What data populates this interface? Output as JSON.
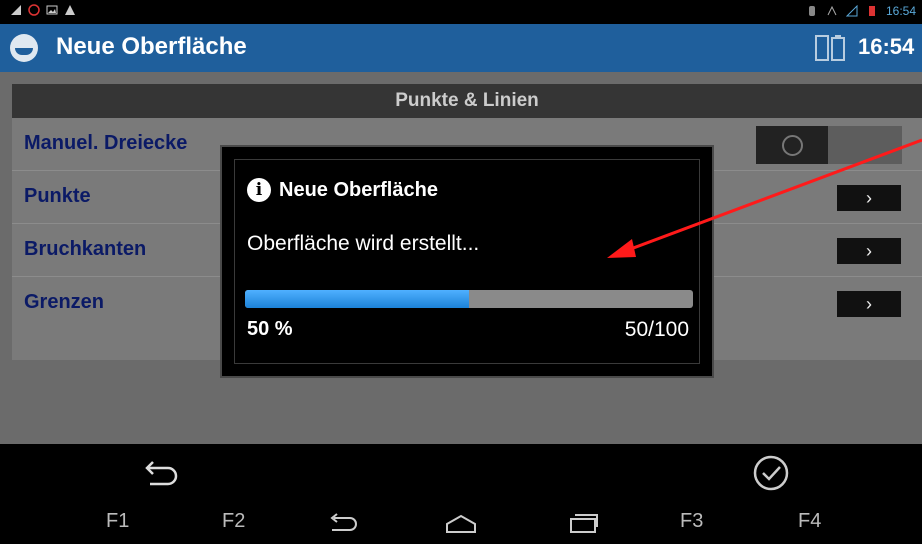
{
  "status_bar": {
    "time": "16:54"
  },
  "action_bar": {
    "title": "Neue Oberfläche",
    "clock": "16:54"
  },
  "section": {
    "header": "Punkte & Linien",
    "rows": [
      {
        "label": "Manuel. Dreiecke"
      },
      {
        "label": "Punkte"
      },
      {
        "label": "Bruchkanten"
      },
      {
        "label": "Grenzen"
      }
    ],
    "arrow_glyph": "›"
  },
  "dialog": {
    "title": "Neue Oberfläche",
    "message": "Oberfläche wird erstellt...",
    "progress": {
      "value": 50,
      "max": 100,
      "percent_label": "50 %",
      "count_label": "50/100"
    }
  },
  "nav": {
    "f1": "F1",
    "f2": "F2",
    "f3": "F3",
    "f4": "F4"
  },
  "colors": {
    "action_bar": "#1f5f9c",
    "progress": "#2f93ea",
    "annotation_arrow": "#ff1a1a"
  }
}
